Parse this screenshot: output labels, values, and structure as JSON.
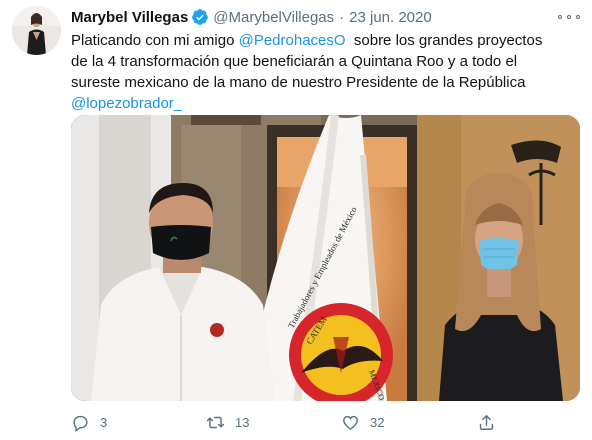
{
  "tweet": {
    "author_name": "Marybel Villegas",
    "handle": "@MarybelVillegas",
    "separator": "·",
    "date": "23 jun. 2020",
    "text_lines": [
      [
        "Platicando con mi amigo ",
        "@PedrohacesO",
        "  sobre los grandes proyectos"
      ],
      [
        "de la 4 transformación que beneficiarán a Quintana Roo y a todo el"
      ],
      [
        "sureste mexicano de la mano de nuestro Presidente de la República"
      ],
      [
        "",
        "@lopezobrador_",
        ""
      ]
    ],
    "text": {
      "l1a": "Platicando con mi amigo ",
      "l1m": "@PedrohacesO",
      "l1b": "  sobre los grandes proyectos",
      "l2": "de la 4 transformación que beneficiarán a Quintana Roo y a todo el",
      "l3": "sureste mexicano de la mano de nuestro Presidente de la República",
      "l4m": "@lopezobrador_"
    },
    "flag_text": {
      "arc": "Trabajadores y Empleados de México",
      "emblem": "CATEM",
      "side": "MEXICO"
    },
    "actions": {
      "replies": "3",
      "retweets": "13",
      "likes": "32"
    }
  },
  "icons": {
    "verified": "verified-badge-icon",
    "more": "more-options-icon",
    "reply": "reply-icon",
    "retweet": "retweet-icon",
    "like": "heart-icon",
    "share": "share-icon"
  },
  "colors": {
    "accent": "#1b95e0",
    "muted": "#5b7083",
    "text": "#0f1419"
  }
}
